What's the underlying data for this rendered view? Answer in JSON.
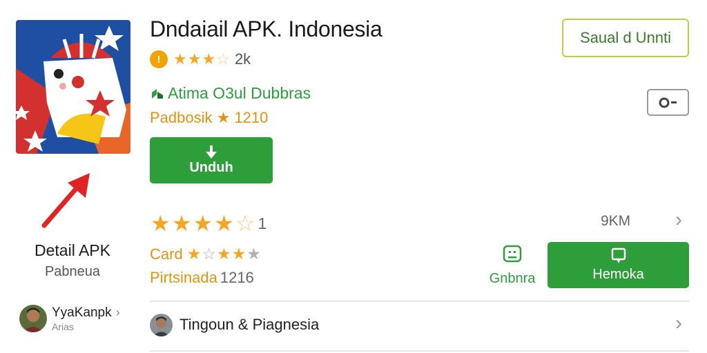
{
  "app": {
    "title": "Dndaiail APK. Indonesia",
    "rating_badge": "!",
    "rating_count": "2k",
    "developer": "Atima O3ul Dubbras",
    "meta": "Padbosik ★ 1210",
    "download_label": "Unduh",
    "outline_button_label": "Saual d Unnti"
  },
  "left": {
    "detail_title": "Detail APK",
    "detail_subtitle": "Pabneua",
    "user_name": "YyaKanpk",
    "user_role": "Arias"
  },
  "ratings": {
    "count_suffix": "1",
    "size": "9KM",
    "card_label": "Card",
    "downloads_label": "Pirtsinada",
    "downloads_value": "1216"
  },
  "actions": {
    "share_label": "Gnbnra",
    "primary_label": "Hemoka"
  },
  "list": {
    "row_label": "Tingoun & Piagnesia"
  },
  "colors": {
    "green": "#2e9e3a",
    "star": "#f5a623",
    "orange_text": "#e09315",
    "outline_border": "#c2cc45"
  },
  "icons": [
    "rating-badge-icon",
    "developer-icon",
    "download-arrow-icon",
    "toggle-icon",
    "share-icon",
    "device-icon",
    "chevron-right-icon",
    "red-arrow-icon"
  ]
}
